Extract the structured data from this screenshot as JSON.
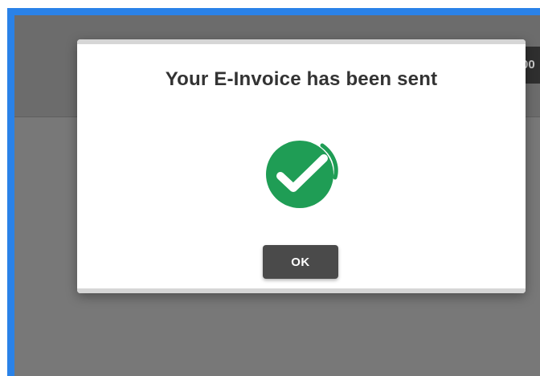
{
  "background": {
    "header_button_label": "00"
  },
  "dialog": {
    "title": "Your E-Invoice has been sent",
    "status_icon": "success-check-icon",
    "ok_label": "OK"
  },
  "colors": {
    "frame_border": "#2a82e8",
    "overlay": "#787878",
    "success_green": "#1f9d55",
    "ok_button": "#4a4a4a"
  }
}
